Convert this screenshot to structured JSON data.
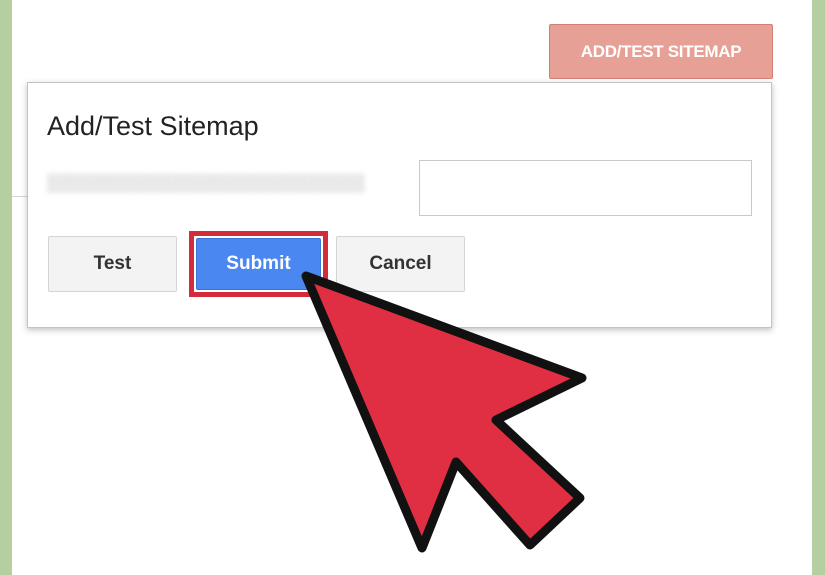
{
  "top_button": {
    "label": "ADD/TEST SITEMAP"
  },
  "dialog": {
    "title": "Add/Test Sitemap",
    "url_input": {
      "value": "",
      "placeholder": ""
    },
    "buttons": {
      "test": "Test",
      "submit": "Submit",
      "cancel": "Cancel"
    }
  },
  "colors": {
    "top_button_bg": "#e6a096",
    "submit_bg": "#4a87f0",
    "highlight": "#d32a3c",
    "pointer_fill": "#e02f43",
    "side_margin": "#b6cfa0"
  },
  "icons": {
    "pointer": "arrow-cursor-icon"
  }
}
